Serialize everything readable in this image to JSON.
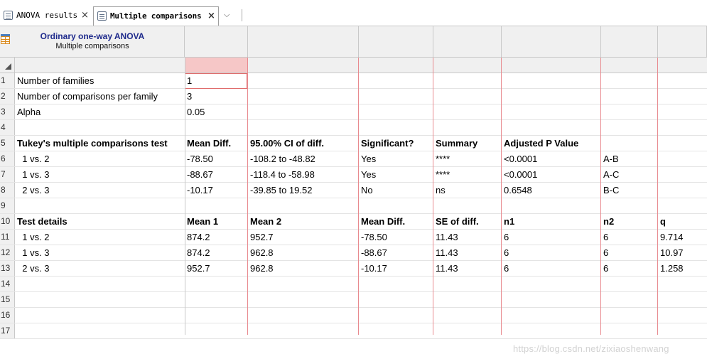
{
  "tabs": [
    {
      "label": "ANOVA results",
      "active": false
    },
    {
      "label": "Multiple comparisons",
      "active": true
    }
  ],
  "tab_close_glyph": "×",
  "tab_menu_glyph": "⌵",
  "sheet": {
    "title": "Ordinary one-way ANOVA",
    "subtitle": "Multiple comparisons"
  },
  "rows": [
    {
      "num": "1",
      "cells": [
        "Number of families",
        "1",
        "",
        "",
        "",
        "",
        "",
        ""
      ],
      "bold": false
    },
    {
      "num": "2",
      "cells": [
        "Number of comparisons per family",
        "3",
        "",
        "",
        "",
        "",
        "",
        ""
      ],
      "bold": false
    },
    {
      "num": "3",
      "cells": [
        "Alpha",
        "0.05",
        "",
        "",
        "",
        "",
        "",
        ""
      ],
      "bold": false
    },
    {
      "num": "4",
      "cells": [
        "",
        "",
        "",
        "",
        "",
        "",
        "",
        ""
      ],
      "bold": false
    },
    {
      "num": "5",
      "cells": [
        "Tukey's multiple comparisons test",
        "Mean Diff.",
        "95.00% CI of diff.",
        "Significant?",
        "Summary",
        "Adjusted P Value",
        "",
        ""
      ],
      "bold": true
    },
    {
      "num": "6",
      "cells": [
        "  1 vs. 2",
        "-78.50",
        "-108.2 to -48.82",
        "Yes",
        "****",
        "<0.0001",
        "A-B",
        ""
      ],
      "bold": false
    },
    {
      "num": "7",
      "cells": [
        "  1 vs. 3",
        "-88.67",
        "-118.4 to -58.98",
        "Yes",
        "****",
        "<0.0001",
        "A-C",
        ""
      ],
      "bold": false
    },
    {
      "num": "8",
      "cells": [
        "  2 vs. 3",
        "-10.17",
        "-39.85 to 19.52",
        "No",
        "ns",
        "0.6548",
        "B-C",
        ""
      ],
      "bold": false
    },
    {
      "num": "9",
      "cells": [
        "",
        "",
        "",
        "",
        "",
        "",
        "",
        ""
      ],
      "bold": false
    },
    {
      "num": "10",
      "cells": [
        "Test details",
        "Mean 1",
        "Mean 2",
        "Mean Diff.",
        "SE of diff.",
        "n1",
        "n2",
        "q"
      ],
      "bold": true
    },
    {
      "num": "11",
      "cells": [
        "  1 vs. 2",
        "874.2",
        "952.7",
        "-78.50",
        "11.43",
        "6",
        "6",
        "9.714"
      ],
      "bold": false
    },
    {
      "num": "12",
      "cells": [
        "  1 vs. 3",
        "874.2",
        "962.8",
        "-88.67",
        "11.43",
        "6",
        "6",
        "10.97"
      ],
      "bold": false
    },
    {
      "num": "13",
      "cells": [
        "  2 vs. 3",
        "952.7",
        "962.8",
        "-10.17",
        "11.43",
        "6",
        "6",
        "1.258"
      ],
      "bold": false
    },
    {
      "num": "14",
      "cells": [
        "",
        "",
        "",
        "",
        "",
        "",
        "",
        ""
      ],
      "bold": false
    },
    {
      "num": "15",
      "cells": [
        "",
        "",
        "",
        "",
        "",
        "",
        "",
        ""
      ],
      "bold": false
    },
    {
      "num": "16",
      "cells": [
        "",
        "",
        "",
        "",
        "",
        "",
        "",
        ""
      ],
      "bold": false
    },
    {
      "num": "17",
      "cells": [
        "",
        "",
        "",
        "",
        "",
        "",
        "",
        ""
      ],
      "bold": false
    }
  ],
  "watermark": "https://blog.csdn.net/zixiaoshenwang",
  "colors": {
    "title_text": "#1f2b8c",
    "selection_header": "#f6c7c7",
    "column_divider_red": "#e88a8f",
    "grid_gray": "#c9c9c9"
  }
}
